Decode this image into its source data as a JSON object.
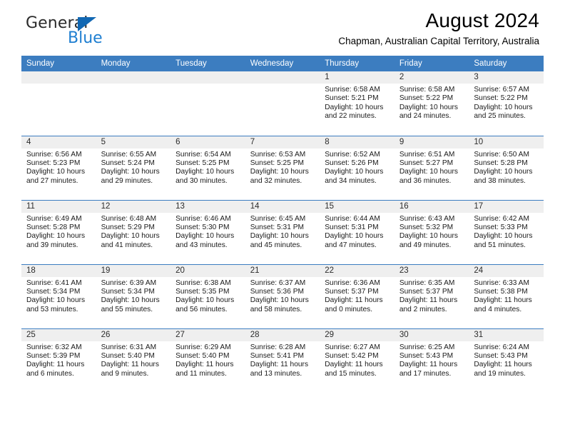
{
  "brand": {
    "name_part1": "General",
    "name_part2": "Blue",
    "triangle_color": "#1268b3",
    "blue_color": "#1f7fd1"
  },
  "header": {
    "title": "August 2024",
    "subtitle": "Chapman, Australian Capital Territory, Australia",
    "header_bg": "#3c7dc0",
    "header_text_color": "#ffffff"
  },
  "calendar": {
    "weekday_headers": [
      "Sunday",
      "Monday",
      "Tuesday",
      "Wednesday",
      "Thursday",
      "Friday",
      "Saturday"
    ],
    "weeks": [
      [
        {
          "day": "",
          "empty": true
        },
        {
          "day": "",
          "empty": true
        },
        {
          "day": "",
          "empty": true
        },
        {
          "day": "",
          "empty": true
        },
        {
          "day": "1",
          "sunrise": "Sunrise: 6:58 AM",
          "sunset": "Sunset: 5:21 PM",
          "daylight1": "Daylight: 10 hours",
          "daylight2": "and 22 minutes."
        },
        {
          "day": "2",
          "sunrise": "Sunrise: 6:58 AM",
          "sunset": "Sunset: 5:22 PM",
          "daylight1": "Daylight: 10 hours",
          "daylight2": "and 24 minutes."
        },
        {
          "day": "3",
          "sunrise": "Sunrise: 6:57 AM",
          "sunset": "Sunset: 5:22 PM",
          "daylight1": "Daylight: 10 hours",
          "daylight2": "and 25 minutes."
        }
      ],
      [
        {
          "day": "4",
          "sunrise": "Sunrise: 6:56 AM",
          "sunset": "Sunset: 5:23 PM",
          "daylight1": "Daylight: 10 hours",
          "daylight2": "and 27 minutes."
        },
        {
          "day": "5",
          "sunrise": "Sunrise: 6:55 AM",
          "sunset": "Sunset: 5:24 PM",
          "daylight1": "Daylight: 10 hours",
          "daylight2": "and 29 minutes."
        },
        {
          "day": "6",
          "sunrise": "Sunrise: 6:54 AM",
          "sunset": "Sunset: 5:25 PM",
          "daylight1": "Daylight: 10 hours",
          "daylight2": "and 30 minutes."
        },
        {
          "day": "7",
          "sunrise": "Sunrise: 6:53 AM",
          "sunset": "Sunset: 5:25 PM",
          "daylight1": "Daylight: 10 hours",
          "daylight2": "and 32 minutes."
        },
        {
          "day": "8",
          "sunrise": "Sunrise: 6:52 AM",
          "sunset": "Sunset: 5:26 PM",
          "daylight1": "Daylight: 10 hours",
          "daylight2": "and 34 minutes."
        },
        {
          "day": "9",
          "sunrise": "Sunrise: 6:51 AM",
          "sunset": "Sunset: 5:27 PM",
          "daylight1": "Daylight: 10 hours",
          "daylight2": "and 36 minutes."
        },
        {
          "day": "10",
          "sunrise": "Sunrise: 6:50 AM",
          "sunset": "Sunset: 5:28 PM",
          "daylight1": "Daylight: 10 hours",
          "daylight2": "and 38 minutes."
        }
      ],
      [
        {
          "day": "11",
          "sunrise": "Sunrise: 6:49 AM",
          "sunset": "Sunset: 5:28 PM",
          "daylight1": "Daylight: 10 hours",
          "daylight2": "and 39 minutes."
        },
        {
          "day": "12",
          "sunrise": "Sunrise: 6:48 AM",
          "sunset": "Sunset: 5:29 PM",
          "daylight1": "Daylight: 10 hours",
          "daylight2": "and 41 minutes."
        },
        {
          "day": "13",
          "sunrise": "Sunrise: 6:46 AM",
          "sunset": "Sunset: 5:30 PM",
          "daylight1": "Daylight: 10 hours",
          "daylight2": "and 43 minutes."
        },
        {
          "day": "14",
          "sunrise": "Sunrise: 6:45 AM",
          "sunset": "Sunset: 5:31 PM",
          "daylight1": "Daylight: 10 hours",
          "daylight2": "and 45 minutes."
        },
        {
          "day": "15",
          "sunrise": "Sunrise: 6:44 AM",
          "sunset": "Sunset: 5:31 PM",
          "daylight1": "Daylight: 10 hours",
          "daylight2": "and 47 minutes."
        },
        {
          "day": "16",
          "sunrise": "Sunrise: 6:43 AM",
          "sunset": "Sunset: 5:32 PM",
          "daylight1": "Daylight: 10 hours",
          "daylight2": "and 49 minutes."
        },
        {
          "day": "17",
          "sunrise": "Sunrise: 6:42 AM",
          "sunset": "Sunset: 5:33 PM",
          "daylight1": "Daylight: 10 hours",
          "daylight2": "and 51 minutes."
        }
      ],
      [
        {
          "day": "18",
          "sunrise": "Sunrise: 6:41 AM",
          "sunset": "Sunset: 5:34 PM",
          "daylight1": "Daylight: 10 hours",
          "daylight2": "and 53 minutes."
        },
        {
          "day": "19",
          "sunrise": "Sunrise: 6:39 AM",
          "sunset": "Sunset: 5:34 PM",
          "daylight1": "Daylight: 10 hours",
          "daylight2": "and 55 minutes."
        },
        {
          "day": "20",
          "sunrise": "Sunrise: 6:38 AM",
          "sunset": "Sunset: 5:35 PM",
          "daylight1": "Daylight: 10 hours",
          "daylight2": "and 56 minutes."
        },
        {
          "day": "21",
          "sunrise": "Sunrise: 6:37 AM",
          "sunset": "Sunset: 5:36 PM",
          "daylight1": "Daylight: 10 hours",
          "daylight2": "and 58 minutes."
        },
        {
          "day": "22",
          "sunrise": "Sunrise: 6:36 AM",
          "sunset": "Sunset: 5:37 PM",
          "daylight1": "Daylight: 11 hours",
          "daylight2": "and 0 minutes."
        },
        {
          "day": "23",
          "sunrise": "Sunrise: 6:35 AM",
          "sunset": "Sunset: 5:37 PM",
          "daylight1": "Daylight: 11 hours",
          "daylight2": "and 2 minutes."
        },
        {
          "day": "24",
          "sunrise": "Sunrise: 6:33 AM",
          "sunset": "Sunset: 5:38 PM",
          "daylight1": "Daylight: 11 hours",
          "daylight2": "and 4 minutes."
        }
      ],
      [
        {
          "day": "25",
          "sunrise": "Sunrise: 6:32 AM",
          "sunset": "Sunset: 5:39 PM",
          "daylight1": "Daylight: 11 hours",
          "daylight2": "and 6 minutes."
        },
        {
          "day": "26",
          "sunrise": "Sunrise: 6:31 AM",
          "sunset": "Sunset: 5:40 PM",
          "daylight1": "Daylight: 11 hours",
          "daylight2": "and 9 minutes."
        },
        {
          "day": "27",
          "sunrise": "Sunrise: 6:29 AM",
          "sunset": "Sunset: 5:40 PM",
          "daylight1": "Daylight: 11 hours",
          "daylight2": "and 11 minutes."
        },
        {
          "day": "28",
          "sunrise": "Sunrise: 6:28 AM",
          "sunset": "Sunset: 5:41 PM",
          "daylight1": "Daylight: 11 hours",
          "daylight2": "and 13 minutes."
        },
        {
          "day": "29",
          "sunrise": "Sunrise: 6:27 AM",
          "sunset": "Sunset: 5:42 PM",
          "daylight1": "Daylight: 11 hours",
          "daylight2": "and 15 minutes."
        },
        {
          "day": "30",
          "sunrise": "Sunrise: 6:25 AM",
          "sunset": "Sunset: 5:43 PM",
          "daylight1": "Daylight: 11 hours",
          "daylight2": "and 17 minutes."
        },
        {
          "day": "31",
          "sunrise": "Sunrise: 6:24 AM",
          "sunset": "Sunset: 5:43 PM",
          "daylight1": "Daylight: 11 hours",
          "daylight2": "and 19 minutes."
        }
      ]
    ]
  }
}
